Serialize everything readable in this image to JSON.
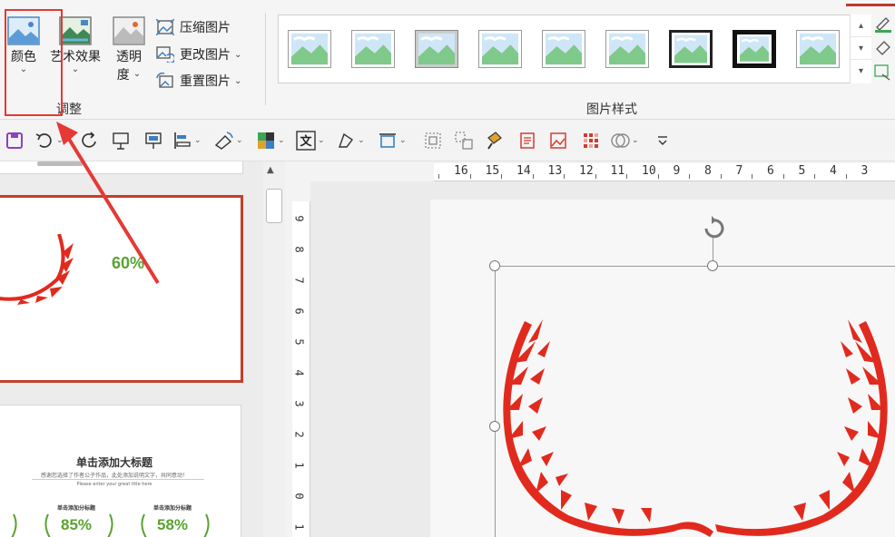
{
  "ribbon": {
    "color_label": "颜色",
    "art_effects_label": "艺术效果",
    "transparency_label_1": "透明",
    "transparency_label_2": "度",
    "compress_label": "压缩图片",
    "change_label": "更改图片",
    "reset_label": "重置图片",
    "adjust_group": "调整",
    "styles_group": "图片样式"
  },
  "thumbnails": {
    "slide1_percent": "60%",
    "slide2_title": "单击添加大标题",
    "slide2_subtitle": "感谢您选择了作者公子作品，此处添加说明文字，共同意动！",
    "slide2_en": "Please enter your great title here",
    "slide2_section_a": "单击添加分标题",
    "slide2_section_b": "单击添加分标题",
    "slide2_pct_a": "85%",
    "slide2_pct_b": "58%"
  },
  "hruler_numbers": [
    "16",
    "15",
    "14",
    "13",
    "12",
    "11",
    "10",
    "9",
    "8",
    "7",
    "6",
    "5",
    "4",
    "3"
  ],
  "vruler_numbers": [
    "9",
    "8",
    "7",
    "6",
    "5",
    "4",
    "3",
    "2",
    "1",
    "0",
    "1"
  ],
  "colors": {
    "accent_red": "#e53935",
    "thumb_green": "#5aa232",
    "laurel_red": "#e12a1e"
  }
}
